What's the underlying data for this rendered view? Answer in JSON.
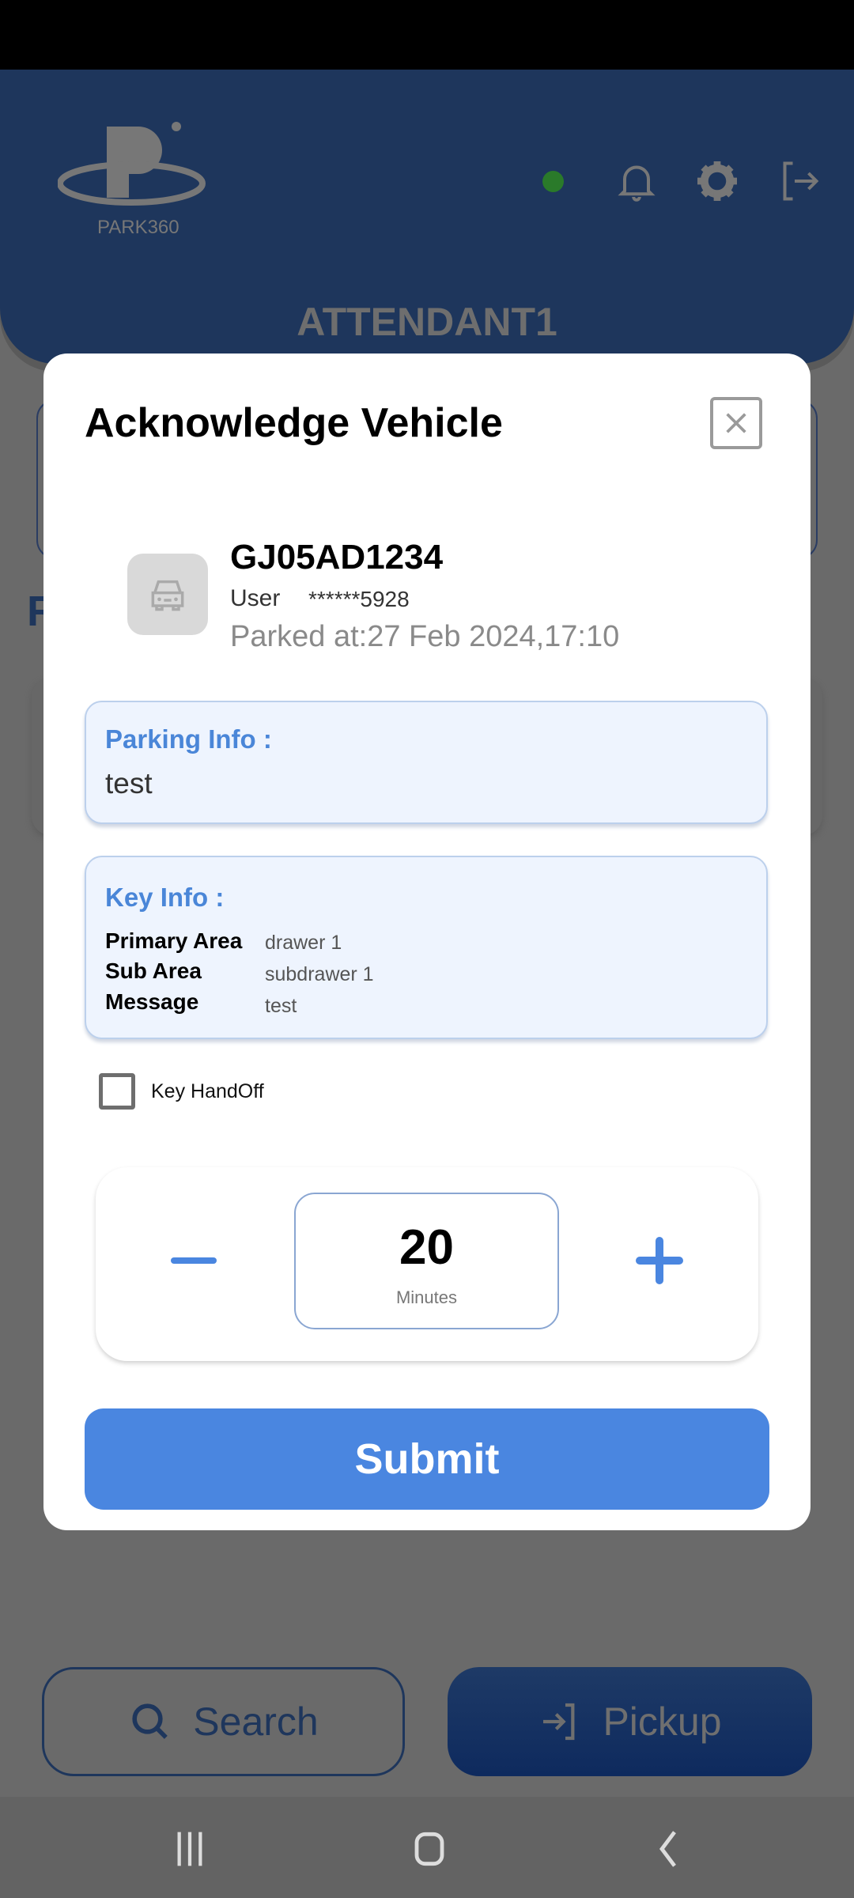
{
  "app": {
    "brand": "PARK360",
    "attendant": "ATTENDANT1",
    "online_status_color": "#2a7a2a"
  },
  "header_icons": [
    "bell-icon",
    "gear-icon",
    "logout-icon"
  ],
  "bottom_actions": {
    "search_label": "Search",
    "pickup_label": "Pickup"
  },
  "modal": {
    "title": "Acknowledge Vehicle",
    "vehicle": {
      "plate": "GJ05AD1234",
      "user_label": "User",
      "user_value": "******5928",
      "parked_at": "Parked at:27 Feb 2024,17:10"
    },
    "parking_info": {
      "label": "Parking Info :",
      "value": "test"
    },
    "key_info": {
      "label": "Key Info :",
      "rows": [
        {
          "label": "Primary Area",
          "value": "drawer 1"
        },
        {
          "label": "Sub Area",
          "value": "subdrawer 1"
        },
        {
          "label": "Message",
          "value": "test"
        }
      ]
    },
    "key_handoff": {
      "label": "Key HandOff",
      "checked": false
    },
    "timer": {
      "value": "20",
      "unit": "Minutes"
    },
    "submit_label": "Submit",
    "accent_color": "#4a86e0"
  }
}
